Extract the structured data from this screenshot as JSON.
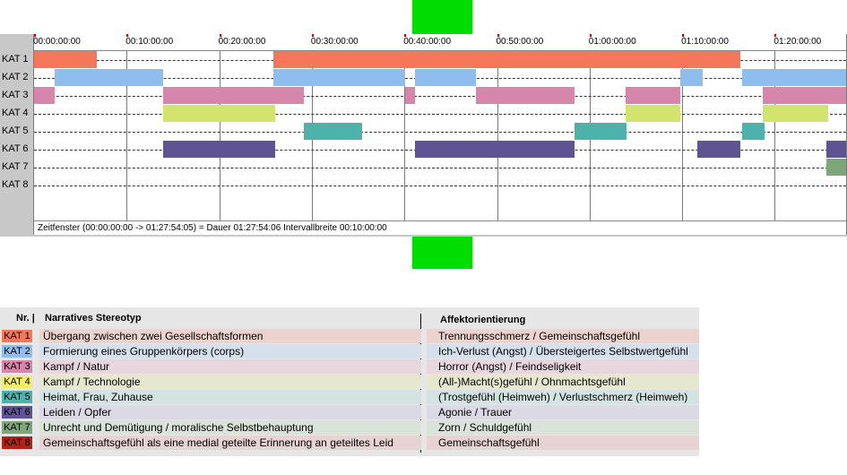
{
  "timeline": {
    "ticks": [
      "00:00:00:00",
      "00:10:00:00",
      "00:20:00:00",
      "00:30:00:00",
      "00:40:00:00",
      "00:50:00:00",
      "01:00:00:00",
      "01:10:00:00",
      "01:20:00:00"
    ],
    "rows": [
      "KAT 1",
      "KAT 2",
      "KAT 3",
      "KAT 4",
      "KAT 5",
      "KAT 6",
      "KAT 7",
      "KAT 8"
    ],
    "status": "Zeitfenster (00:00:00:00 -> 01:27:54:05) = Dauer 01:27:54:06    Intervallbreite 00:10:00:00",
    "total_minutes": 87.9,
    "colors": [
      "#f4775a",
      "#8ebdef",
      "#d686aa",
      "#d2e36e",
      "#4fb2aa",
      "#5f5393",
      "#7ea67a",
      "#8b1a1a"
    ],
    "segments": [
      {
        "row": 0,
        "start": 0,
        "end": 6.8
      },
      {
        "row": 0,
        "start": 25.8,
        "end": 76.3
      },
      {
        "row": 1,
        "start": 2.2,
        "end": 13.9
      },
      {
        "row": 1,
        "start": 25.8,
        "end": 40.1
      },
      {
        "row": 1,
        "start": 41.1,
        "end": 47.7
      },
      {
        "row": 1,
        "start": 69.8,
        "end": 72.2
      },
      {
        "row": 1,
        "start": 76.5,
        "end": 87.9
      },
      {
        "row": 2,
        "start": 0,
        "end": 2.2
      },
      {
        "row": 2,
        "start": 13.9,
        "end": 29.1
      },
      {
        "row": 2,
        "start": 40.1,
        "end": 41.1
      },
      {
        "row": 2,
        "start": 47.7,
        "end": 58.4
      },
      {
        "row": 2,
        "start": 63.9,
        "end": 69.8
      },
      {
        "row": 2,
        "start": 78.7,
        "end": 87.9
      },
      {
        "row": 3,
        "start": 13.9,
        "end": 26.0
      },
      {
        "row": 3,
        "start": 63.9,
        "end": 69.8
      },
      {
        "row": 3,
        "start": 78.7,
        "end": 85.8
      },
      {
        "row": 4,
        "start": 29.1,
        "end": 35.4
      },
      {
        "row": 4,
        "start": 58.4,
        "end": 64.0
      },
      {
        "row": 4,
        "start": 76.5,
        "end": 78.9
      },
      {
        "row": 5,
        "start": 13.9,
        "end": 26.0
      },
      {
        "row": 5,
        "start": 41.1,
        "end": 58.4
      },
      {
        "row": 5,
        "start": 71.6,
        "end": 76.3
      },
      {
        "row": 5,
        "start": 85.6,
        "end": 87.9
      },
      {
        "row": 6,
        "start": 85.6,
        "end": 87.9
      }
    ]
  },
  "legend": {
    "header_nr": "Nr. |",
    "header_stereotyp": "Narratives Stereotyp",
    "header_affekt": "Affektorientierung",
    "rows": [
      {
        "kat": "KAT 1",
        "color": "#f4775a",
        "bg": "#ecd3cd",
        "stereotyp": "Übergang zwischen zwei Gesellschaftsformen",
        "affekt": "Trennungsschmerz / Gemeinschaftsgefühl"
      },
      {
        "kat": "KAT 2",
        "color": "#8ebdef",
        "bg": "#d6e0ec",
        "stereotyp": "Formierung eines Gruppenkörpers (corps)",
        "affekt": "Ich-Verlust (Angst) / Übersteigertes Selbstwertgefühl"
      },
      {
        "kat": "KAT 3",
        "color": "#d686aa",
        "bg": "#e8d6de",
        "stereotyp": "Kampf / Natur",
        "affekt": "Horror (Angst) / Feindseligkeit"
      },
      {
        "kat": "KAT 4",
        "color": "#f2ef64",
        "bg": "#e6e7cf",
        "stereotyp": "Kampf / Technologie",
        "affekt": "(All-)Macht(s)gefühl / Ohnmachtsgefühl"
      },
      {
        "kat": "KAT 5",
        "color": "#4fb2aa",
        "bg": "#d3e3e1",
        "stereotyp": "Heimat, Frau, Zuhause",
        "affekt": "(Trostgefühl (Heimweh) / Verlustschmerz (Heimweh)"
      },
      {
        "kat": "KAT 6",
        "color": "#5f5393",
        "bg": "#dbd9e4",
        "stereotyp": "Leiden / Opfer",
        "affekt": "Agonie / Trauer"
      },
      {
        "kat": "KAT 7",
        "color": "#7ea67a",
        "bg": "#dae3d8",
        "stereotyp": "Unrecht und Demütigung / moralische Selbstbehauptung",
        "affekt": "Zorn / Schuldgefühl"
      },
      {
        "kat": "KAT 8",
        "color": "#b32217",
        "bg": "#e6d3d2",
        "stereotyp": "Gemeinschaftsgefühl als eine medial geteilte Erinnerung an geteiltes Leid",
        "affekt": "Gemeinschaftsgefühl"
      }
    ]
  }
}
